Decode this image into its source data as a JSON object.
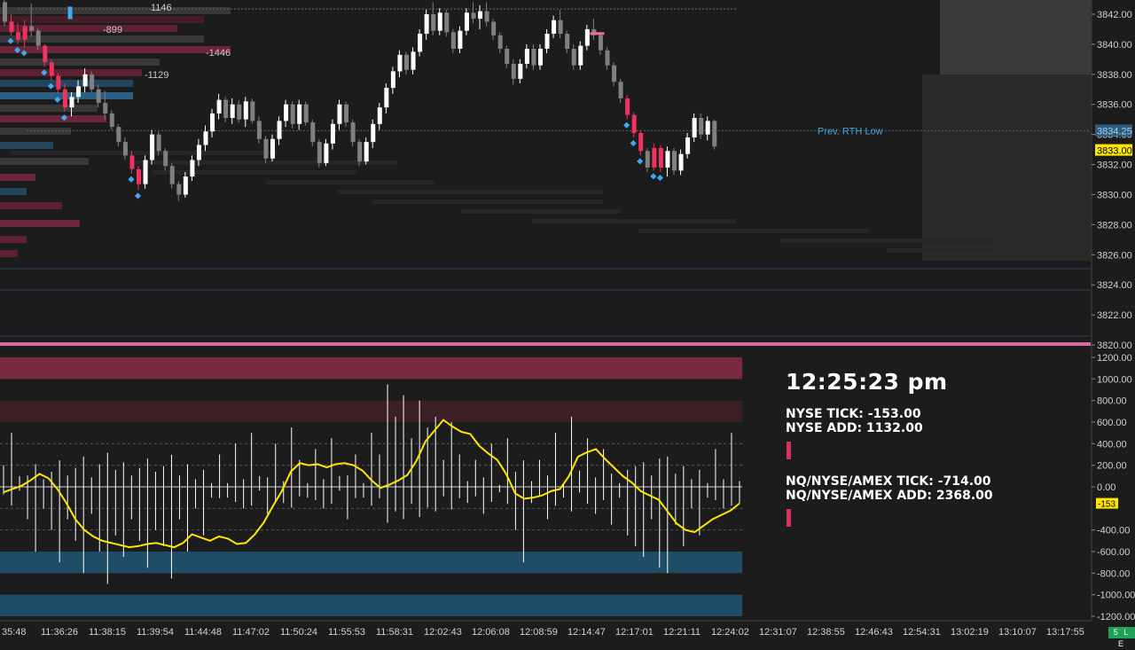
{
  "app": {
    "live_badge": "5 L E"
  },
  "colors": {
    "background": "#1c1c1c",
    "bull_candle": "#ffffff",
    "bear_candle": "#808080",
    "down_trend_candle": "#f0325f",
    "up_trend_candle": "#2aa3e0",
    "tick_line": "#ffffff",
    "tick_ma": "#ffe600",
    "last_price_bg": "#ffe600",
    "prev_low_color": "#4aa3d8",
    "extreme_up_band": "#7a2a3f",
    "extreme_down_band": "#1f4c66",
    "separator": "#d36a9b"
  },
  "price_pane": {
    "y_ticks": [
      "3842.00",
      "3840.00",
      "3838.00",
      "3836.00",
      "3834.00",
      "3832.00",
      "3830.00",
      "3828.00",
      "3826.00",
      "3824.00",
      "3822.00",
      "3820.00"
    ],
    "prev_rth_low_label": "Prev. RTH Low",
    "prev_rth_low_price": "3834.25",
    "last_price": "3833.00",
    "delta_labels": [
      "1146",
      "-899",
      "-1446",
      "-1129"
    ]
  },
  "indicator_pane": {
    "y_ticks": [
      "1200.00",
      "1000.00",
      "800.00",
      "600.00",
      "400.00",
      "200.00",
      "0.00",
      "-400.00",
      "-600.00",
      "-800.00",
      "-1000.00",
      "-1200.00"
    ],
    "current_value_label": "-153"
  },
  "x_axis": {
    "labels": [
      "35:48",
      "11:36:26",
      "11:38:15",
      "11:39:54",
      "11:44:48",
      "11:47:02",
      "11:50:24",
      "11:55:53",
      "11:58:31",
      "12:02:43",
      "12:06:08",
      "12:08:59",
      "12:14:47",
      "12:17:01",
      "12:21:11",
      "12:24:02",
      "12:31:07",
      "12:38:55",
      "12:46:43",
      "12:54:31",
      "13:02:19",
      "13:10:07",
      "13:17:55"
    ]
  },
  "info": {
    "clock": "12:25:23 pm",
    "nyse_tick": "NYSE TICK: -153.00",
    "nyse_add": "NYSE ADD: 1132.00",
    "combined_tick": "NQ/NYSE/AMEX TICK: -714.00",
    "combined_add": "NQ/NYSE/AMEX ADD: 2368.00"
  },
  "chart_data": {
    "type": "candlestick",
    "price_axis": {
      "min": 3820,
      "max": 3842
    },
    "prev_rth_low": 3834.25,
    "last": 3833.0,
    "bars": [
      [
        3842.8,
        3843.5,
        3841.2,
        3841.5
      ],
      [
        3841.5,
        3842.0,
        3840.6,
        3840.8
      ],
      [
        3840.8,
        3841.4,
        3840.0,
        3840.3
      ],
      [
        3840.3,
        3841.6,
        3839.8,
        3841.2
      ],
      [
        3841.2,
        3842.7,
        3840.5,
        3840.9
      ],
      [
        3840.9,
        3841.1,
        3839.6,
        3839.9
      ],
      [
        3839.9,
        3840.0,
        3838.5,
        3838.8
      ],
      [
        3838.8,
        3839.0,
        3837.6,
        3837.9
      ],
      [
        3837.9,
        3838.1,
        3836.7,
        3837.0
      ],
      [
        3837.0,
        3837.4,
        3835.5,
        3835.8
      ],
      [
        3835.8,
        3836.8,
        3835.2,
        3836.5
      ],
      [
        3836.5,
        3837.6,
        3836.1,
        3837.2
      ],
      [
        3837.2,
        3838.4,
        3836.8,
        3838.0
      ],
      [
        3838.0,
        3838.2,
        3836.8,
        3837.0
      ],
      [
        3837.0,
        3837.3,
        3835.8,
        3836.1
      ],
      [
        3836.1,
        3836.9,
        3835.0,
        3835.4
      ],
      [
        3835.4,
        3835.6,
        3834.3,
        3834.5
      ],
      [
        3834.5,
        3834.7,
        3833.2,
        3833.5
      ],
      [
        3833.5,
        3833.8,
        3832.3,
        3832.6
      ],
      [
        3832.6,
        3832.9,
        3831.4,
        3831.7
      ],
      [
        3831.7,
        3831.9,
        3830.3,
        3830.7
      ],
      [
        3830.7,
        3832.6,
        3830.4,
        3832.3
      ],
      [
        3832.3,
        3834.3,
        3832.0,
        3834.0
      ],
      [
        3834.0,
        3834.2,
        3832.6,
        3832.9
      ],
      [
        3832.9,
        3833.1,
        3831.6,
        3831.9
      ],
      [
        3831.9,
        3832.1,
        3830.4,
        3830.7
      ],
      [
        3830.7,
        3830.9,
        3829.6,
        3830.0
      ],
      [
        3830.0,
        3831.5,
        3829.8,
        3831.2
      ],
      [
        3831.2,
        3832.6,
        3830.9,
        3832.3
      ],
      [
        3832.3,
        3833.7,
        3831.9,
        3833.3
      ],
      [
        3833.3,
        3834.6,
        3832.9,
        3834.2
      ],
      [
        3834.2,
        3835.7,
        3833.8,
        3835.4
      ],
      [
        3835.4,
        3836.7,
        3835.0,
        3836.3
      ],
      [
        3836.3,
        3836.5,
        3834.8,
        3835.1
      ],
      [
        3835.1,
        3836.4,
        3834.7,
        3836.0
      ],
      [
        3836.0,
        3836.3,
        3834.8,
        3835.0
      ],
      [
        3835.0,
        3836.5,
        3834.5,
        3836.2
      ],
      [
        3836.2,
        3836.4,
        3834.7,
        3834.9
      ],
      [
        3834.9,
        3835.2,
        3833.4,
        3833.7
      ],
      [
        3833.7,
        3833.9,
        3832.1,
        3832.4
      ],
      [
        3832.4,
        3834.0,
        3832.2,
        3833.7
      ],
      [
        3833.7,
        3835.2,
        3833.3,
        3834.9
      ],
      [
        3834.9,
        3836.3,
        3834.5,
        3836.0
      ],
      [
        3836.0,
        3836.2,
        3834.4,
        3834.7
      ],
      [
        3834.7,
        3836.3,
        3834.3,
        3836.0
      ],
      [
        3836.0,
        3836.2,
        3834.6,
        3834.8
      ],
      [
        3834.8,
        3835.0,
        3833.2,
        3833.5
      ],
      [
        3833.5,
        3833.7,
        3831.8,
        3832.1
      ],
      [
        3832.1,
        3833.7,
        3831.9,
        3833.4
      ],
      [
        3833.4,
        3835.0,
        3833.0,
        3834.7
      ],
      [
        3834.7,
        3836.3,
        3834.3,
        3836.0
      ],
      [
        3836.0,
        3836.2,
        3834.5,
        3834.8
      ],
      [
        3834.8,
        3835.0,
        3833.2,
        3833.5
      ],
      [
        3833.5,
        3833.7,
        3831.9,
        3832.2
      ],
      [
        3832.2,
        3833.8,
        3832.0,
        3833.5
      ],
      [
        3833.5,
        3835.0,
        3833.1,
        3834.7
      ],
      [
        3834.7,
        3836.1,
        3834.3,
        3835.8
      ],
      [
        3835.8,
        3837.4,
        3835.4,
        3837.1
      ],
      [
        3837.1,
        3838.5,
        3836.7,
        3838.2
      ],
      [
        3838.2,
        3839.6,
        3837.8,
        3839.3
      ],
      [
        3839.3,
        3839.5,
        3838.0,
        3838.3
      ],
      [
        3838.3,
        3839.8,
        3838.0,
        3839.5
      ],
      [
        3839.5,
        3841.0,
        3839.2,
        3840.7
      ],
      [
        3840.7,
        3842.3,
        3840.3,
        3842.0
      ],
      [
        3842.0,
        3842.8,
        3840.6,
        3840.9
      ],
      [
        3840.9,
        3842.4,
        3840.6,
        3842.1
      ],
      [
        3842.1,
        3842.3,
        3840.5,
        3840.8
      ],
      [
        3840.8,
        3841.0,
        3839.4,
        3839.7
      ],
      [
        3839.7,
        3841.2,
        3839.4,
        3840.9
      ],
      [
        3840.9,
        3842.4,
        3840.6,
        3842.1
      ],
      [
        3842.1,
        3842.8,
        3841.4,
        3841.7
      ],
      [
        3841.7,
        3842.6,
        3841.0,
        3842.2
      ],
      [
        3842.2,
        3842.8,
        3841.2,
        3841.5
      ],
      [
        3841.5,
        3841.7,
        3840.3,
        3840.6
      ],
      [
        3840.6,
        3840.8,
        3839.4,
        3839.7
      ],
      [
        3839.7,
        3839.9,
        3838.4,
        3838.7
      ],
      [
        3838.7,
        3839.0,
        3837.3,
        3837.7
      ],
      [
        3837.7,
        3839.0,
        3837.4,
        3838.7
      ],
      [
        3838.7,
        3840.0,
        3838.4,
        3839.7
      ],
      [
        3839.7,
        3840.0,
        3838.3,
        3838.6
      ],
      [
        3838.6,
        3840.0,
        3838.3,
        3839.7
      ],
      [
        3839.7,
        3841.0,
        3839.4,
        3840.7
      ],
      [
        3840.7,
        3841.9,
        3840.4,
        3841.6
      ],
      [
        3841.6,
        3842.3,
        3840.4,
        3840.7
      ],
      [
        3840.7,
        3840.9,
        3839.4,
        3839.7
      ],
      [
        3839.7,
        3840.0,
        3838.3,
        3838.6
      ],
      [
        3838.6,
        3840.2,
        3838.3,
        3839.9
      ],
      [
        3839.9,
        3841.3,
        3839.6,
        3841.0
      ],
      [
        3841.0,
        3841.7,
        3840.3,
        3840.6
      ],
      [
        3840.6,
        3840.8,
        3839.3,
        3839.6
      ],
      [
        3839.6,
        3839.8,
        3838.3,
        3838.6
      ],
      [
        3838.6,
        3838.8,
        3837.2,
        3837.5
      ],
      [
        3837.5,
        3837.7,
        3836.1,
        3836.4
      ],
      [
        3836.4,
        3836.6,
        3835.0,
        3835.3
      ],
      [
        3835.3,
        3835.5,
        3833.8,
        3834.1
      ],
      [
        3834.1,
        3834.3,
        3832.6,
        3832.9
      ],
      [
        3832.9,
        3833.1,
        3831.5,
        3831.8
      ],
      [
        3831.8,
        3833.4,
        3831.6,
        3833.1
      ],
      [
        3833.1,
        3833.3,
        3831.5,
        3831.8
      ],
      [
        3831.8,
        3833.2,
        3831.2,
        3832.9
      ],
      [
        3832.9,
        3833.1,
        3831.3,
        3831.6
      ],
      [
        3831.6,
        3833.0,
        3831.3,
        3832.7
      ],
      [
        3832.7,
        3834.1,
        3832.4,
        3833.8
      ],
      [
        3833.8,
        3835.4,
        3833.5,
        3835.1
      ],
      [
        3835.1,
        3835.4,
        3833.7,
        3834.0
      ],
      [
        3834.0,
        3835.2,
        3833.6,
        3834.9
      ],
      [
        3834.9,
        3835.0,
        3833.0,
        3833.2
      ]
    ],
    "downtrend_bar_indices": [
      1,
      2,
      3,
      6,
      7,
      8,
      9,
      19,
      20,
      93,
      94,
      95,
      97,
      98
    ],
    "tick_series": {
      "min": -1200,
      "max": 1200,
      "values": [
        200,
        500,
        100,
        -300,
        -600,
        -200,
        -400,
        -700,
        -300,
        -500,
        -800,
        -250,
        -600,
        -900,
        -450,
        -650,
        -300,
        -500,
        -750,
        -400,
        -550,
        -850,
        -300,
        -600,
        -200,
        -450,
        -100,
        300,
        -100,
        400,
        -200,
        500,
        100,
        -250,
        400,
        -150,
        550,
        250,
        -100,
        350,
        -200,
        450,
        100,
        -300,
        300,
        -100,
        500,
        300,
        950,
        650,
        850,
        450,
        800,
        550,
        650,
        250,
        600,
        300,
        -150,
        250,
        -250,
        400,
        -50,
        450,
        -400,
        -700,
        -150,
        250,
        -300,
        500,
        -100,
        650,
        150,
        450,
        -250,
        350,
        -350,
        -100,
        -450,
        -550,
        -650,
        -300,
        -750,
        -800,
        -350,
        -550,
        -200,
        -450,
        -100,
        350,
        -200,
        500,
        -153
      ],
      "ma_values": [
        -50,
        -20,
        10,
        60,
        120,
        80,
        -20,
        -150,
        -300,
        -400,
        -460,
        -500,
        -520,
        -540,
        -560,
        -550,
        -530,
        -520,
        -540,
        -560,
        -520,
        -440,
        -470,
        -500,
        -460,
        -480,
        -530,
        -520,
        -440,
        -330,
        -180,
        -40,
        140,
        220,
        200,
        210,
        180,
        210,
        220,
        200,
        150,
        60,
        -10,
        20,
        60,
        110,
        240,
        420,
        520,
        620,
        560,
        510,
        490,
        380,
        310,
        250,
        120,
        -60,
        -110,
        -100,
        -80,
        -40,
        -20,
        100,
        280,
        320,
        350,
        260,
        180,
        100,
        40,
        -40,
        -80,
        -120,
        -230,
        -340,
        -400,
        -420,
        -360,
        -300,
        -260,
        -220,
        -153
      ],
      "upper_extreme_band": [
        800,
        1200
      ],
      "lower_extreme_band": [
        -1200,
        -600
      ]
    }
  }
}
